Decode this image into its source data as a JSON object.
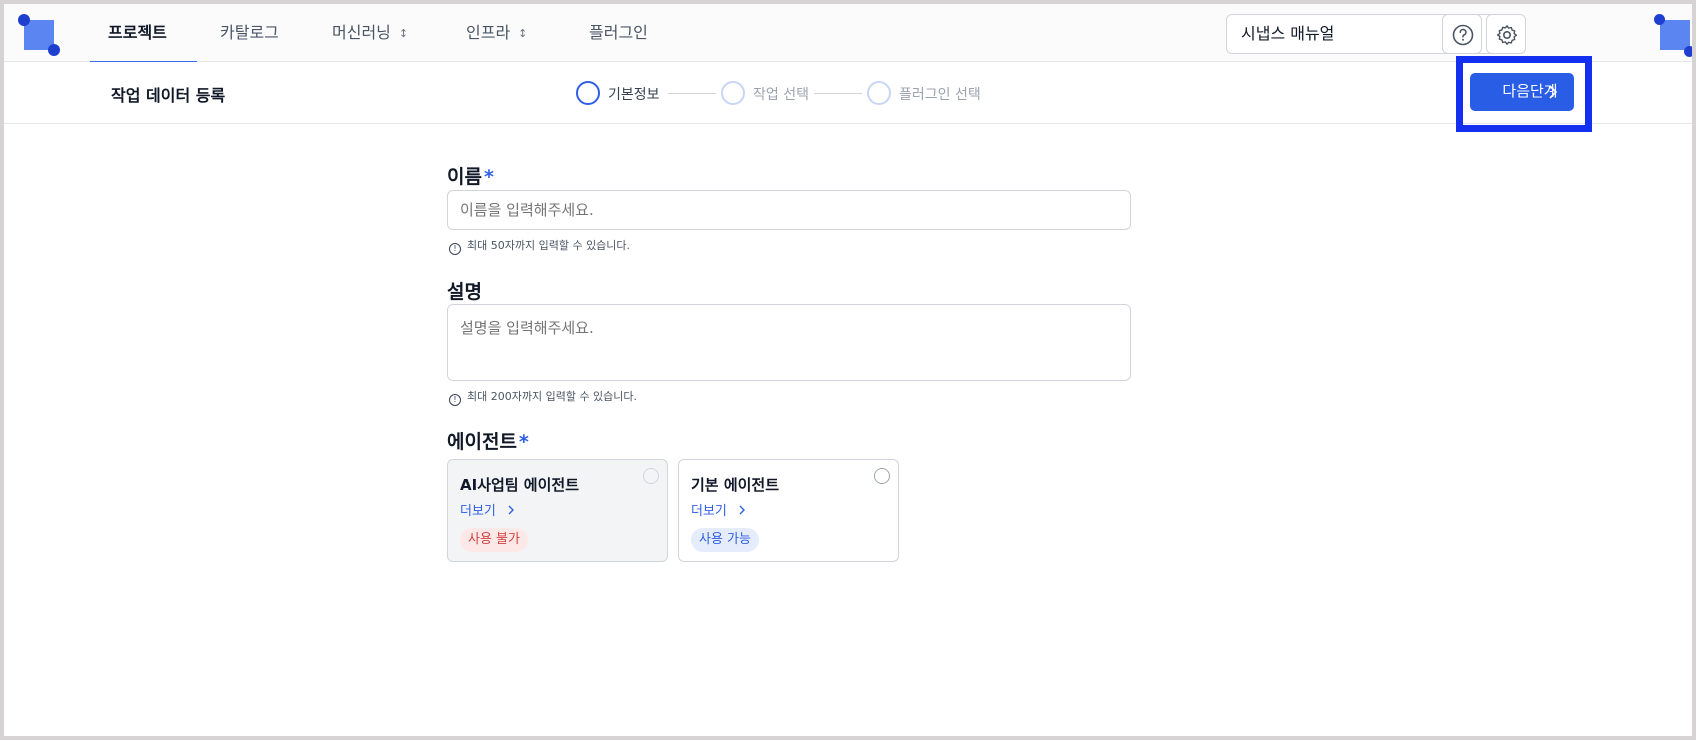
{
  "nav": {
    "items": [
      {
        "label": "프로젝트",
        "active": true,
        "has_dropdown": false
      },
      {
        "label": "카탈로그",
        "active": false,
        "has_dropdown": false
      },
      {
        "label": "머신러닝",
        "active": false,
        "has_dropdown": true
      },
      {
        "label": "인프라",
        "active": false,
        "has_dropdown": true
      },
      {
        "label": "플러그인",
        "active": false,
        "has_dropdown": false
      }
    ],
    "workspace_selected": "시냅스 매뉴얼",
    "icons": {
      "help": "help-circle-icon",
      "settings": "gear-icon",
      "dropdown": "chevron-down-icon"
    }
  },
  "subheader": {
    "title": "작업 데이터 등록",
    "steps": [
      {
        "label": "기본정보",
        "active": true
      },
      {
        "label": "작업 선택",
        "active": false
      },
      {
        "label": "플러그인 선택",
        "active": false
      }
    ],
    "next_label": "다음단계"
  },
  "form": {
    "name": {
      "label": "이름",
      "required_mark": "*",
      "placeholder": "이름을 입력해주세요.",
      "value": "",
      "hint": "최대 50자까지 입력할 수 있습니다."
    },
    "description": {
      "label": "설명",
      "placeholder": "설명을 입력해주세요.",
      "value": "",
      "hint": "최대 200자까지 입력할 수 있습니다."
    },
    "agent": {
      "label": "에이전트",
      "required_mark": "*",
      "options": [
        {
          "name": "AI사업팀 에이전트",
          "more_label": "더보기",
          "status": "사용 불가",
          "available": false
        },
        {
          "name": "기본 에이전트",
          "more_label": "더보기",
          "status": "사용 가능",
          "available": true
        }
      ]
    }
  },
  "colors": {
    "accent": "#2a5de6",
    "highlight_outline": "#1330f0",
    "unavailable": "#d14343",
    "available": "#2f5ee6"
  }
}
